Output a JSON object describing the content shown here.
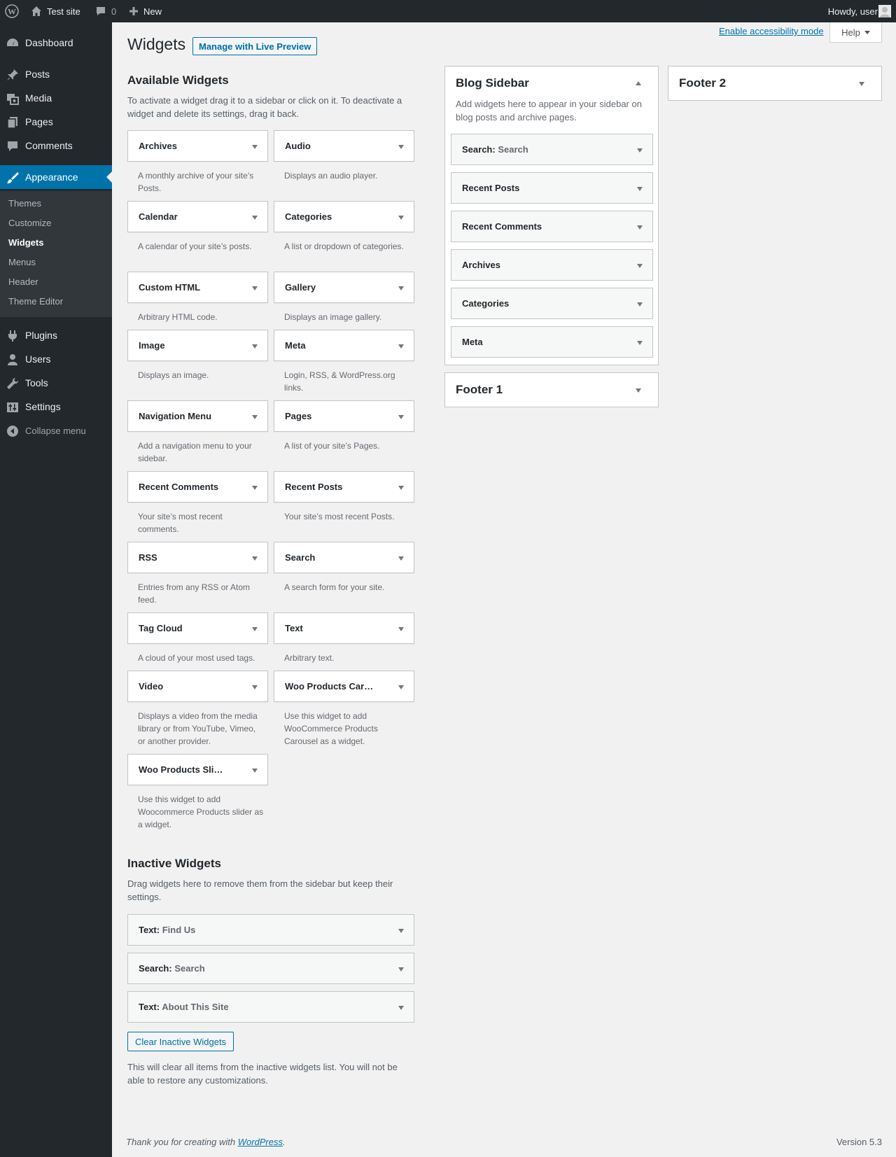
{
  "adminbar": {
    "site_name": "Test site",
    "comments_count": "0",
    "new_label": "New",
    "howdy": "Howdy, user"
  },
  "menu": {
    "dashboard": "Dashboard",
    "posts": "Posts",
    "media": "Media",
    "pages": "Pages",
    "comments": "Comments",
    "appearance": "Appearance",
    "sub": [
      "Themes",
      "Customize",
      "Widgets",
      "Menus",
      "Header",
      "Theme Editor"
    ],
    "plugins": "Plugins",
    "users": "Users",
    "tools": "Tools",
    "settings": "Settings",
    "collapse": "Collapse menu"
  },
  "header": {
    "title": "Widgets",
    "live_preview": "Manage with Live Preview",
    "a11y": "Enable accessibility mode",
    "help": "Help"
  },
  "available": {
    "heading": "Available Widgets",
    "description": "To activate a widget drag it to a sidebar or click on it. To deactivate a widget and delete its settings, drag it back.",
    "widgets": [
      {
        "title": "Archives",
        "desc": "A monthly archive of your site’s Posts."
      },
      {
        "title": "Audio",
        "desc": "Displays an audio player."
      },
      {
        "title": "Calendar",
        "desc": "A calendar of your site’s posts."
      },
      {
        "title": "Categories",
        "desc": "A list or dropdown of categories."
      },
      {
        "title": "Custom HTML",
        "desc": "Arbitrary HTML code."
      },
      {
        "title": "Gallery",
        "desc": "Displays an image gallery."
      },
      {
        "title": "Image",
        "desc": "Displays an image."
      },
      {
        "title": "Meta",
        "desc": "Login, RSS, & WordPress.org links."
      },
      {
        "title": "Navigation Menu",
        "desc": "Add a navigation menu to your sidebar."
      },
      {
        "title": "Pages",
        "desc": "A list of your site’s Pages."
      },
      {
        "title": "Recent Comments",
        "desc": "Your site’s most recent comments."
      },
      {
        "title": "Recent Posts",
        "desc": "Your site’s most recent Posts."
      },
      {
        "title": "RSS",
        "desc": "Entries from any RSS or Atom feed."
      },
      {
        "title": "Search",
        "desc": "A search form for your site."
      },
      {
        "title": "Tag Cloud",
        "desc": "A cloud of your most used tags."
      },
      {
        "title": "Text",
        "desc": "Arbitrary text."
      },
      {
        "title": "Video",
        "desc": "Displays a video from the media library or from YouTube, Vimeo, or another provider."
      },
      {
        "title": "Woo Products Car…",
        "desc": "Use this widget to add WooCommerce Products Carousel as a widget."
      },
      {
        "title": "Woo Products Sli…",
        "desc": "Use this widget to add Woocommerce Products slider as a widget."
      }
    ]
  },
  "blog_sidebar": {
    "title": "Blog Sidebar",
    "description": "Add widgets here to appear in your sidebar on blog posts and archive pages.",
    "widgets": [
      {
        "title": "Search:",
        "sub": "Search"
      },
      {
        "title": "Recent Posts",
        "sub": ""
      },
      {
        "title": "Recent Comments",
        "sub": ""
      },
      {
        "title": "Archives",
        "sub": ""
      },
      {
        "title": "Categories",
        "sub": ""
      },
      {
        "title": "Meta",
        "sub": ""
      }
    ]
  },
  "footer1": {
    "title": "Footer 1"
  },
  "footer2": {
    "title": "Footer 2"
  },
  "inactive": {
    "heading": "Inactive Widgets",
    "description": "Drag widgets here to remove them from the sidebar but keep their settings.",
    "widgets": [
      {
        "title": "Text:",
        "sub": "Find Us"
      },
      {
        "title": "Search:",
        "sub": "Search"
      },
      {
        "title": "Text:",
        "sub": "About This Site"
      }
    ],
    "clear_button": "Clear Inactive Widgets",
    "clear_note": "This will clear all items from the inactive widgets list. You will not be able to restore any customizations."
  },
  "footer": {
    "thanks_prefix": "Thank you for creating with",
    "thanks_link": "WordPress",
    "thanks_suffix": ".",
    "version": "Version 5.3"
  }
}
